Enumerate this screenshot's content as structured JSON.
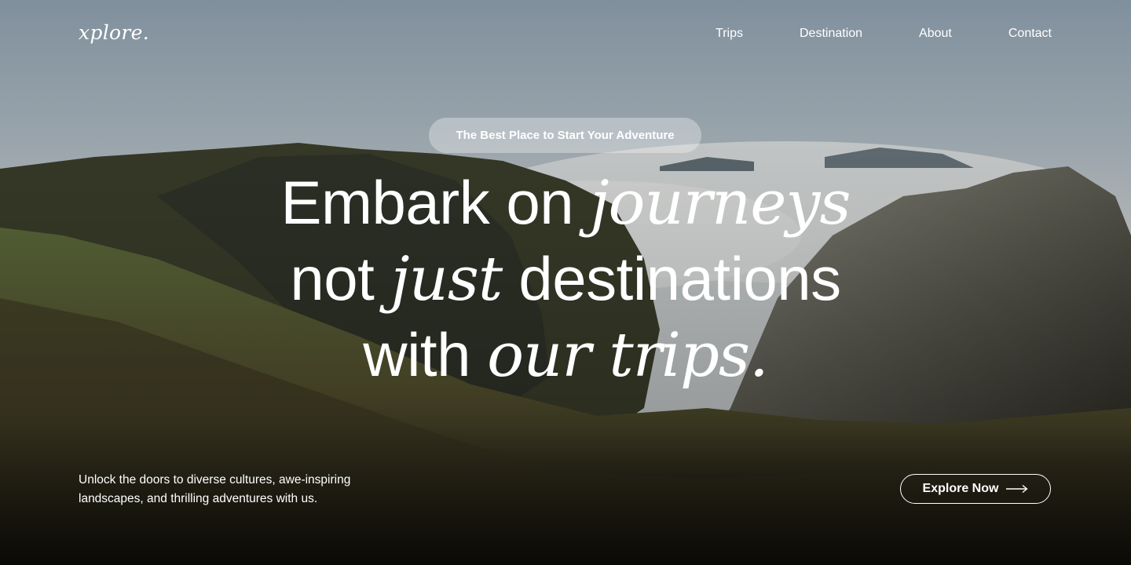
{
  "brand": {
    "logo": "xplore."
  },
  "nav": {
    "items": [
      {
        "label": "Trips"
      },
      {
        "label": "Destination"
      },
      {
        "label": "About"
      },
      {
        "label": "Contact"
      }
    ]
  },
  "hero": {
    "tagline": "The Best Place to Start Your Adventure",
    "headline": {
      "line1_a": "Embark on ",
      "line1_b": "journeys",
      "line2_a": "not ",
      "line2_b": "just",
      "line2_c": " destinations",
      "line3_a": "with ",
      "line3_b": "our trips."
    },
    "description": "Unlock the doors to diverse cultures, awe-inspiring landscapes, and thrilling adventures with us.",
    "cta_label": "Explore Now"
  },
  "icons": {
    "cta_icon": "arrow-right-icon"
  }
}
